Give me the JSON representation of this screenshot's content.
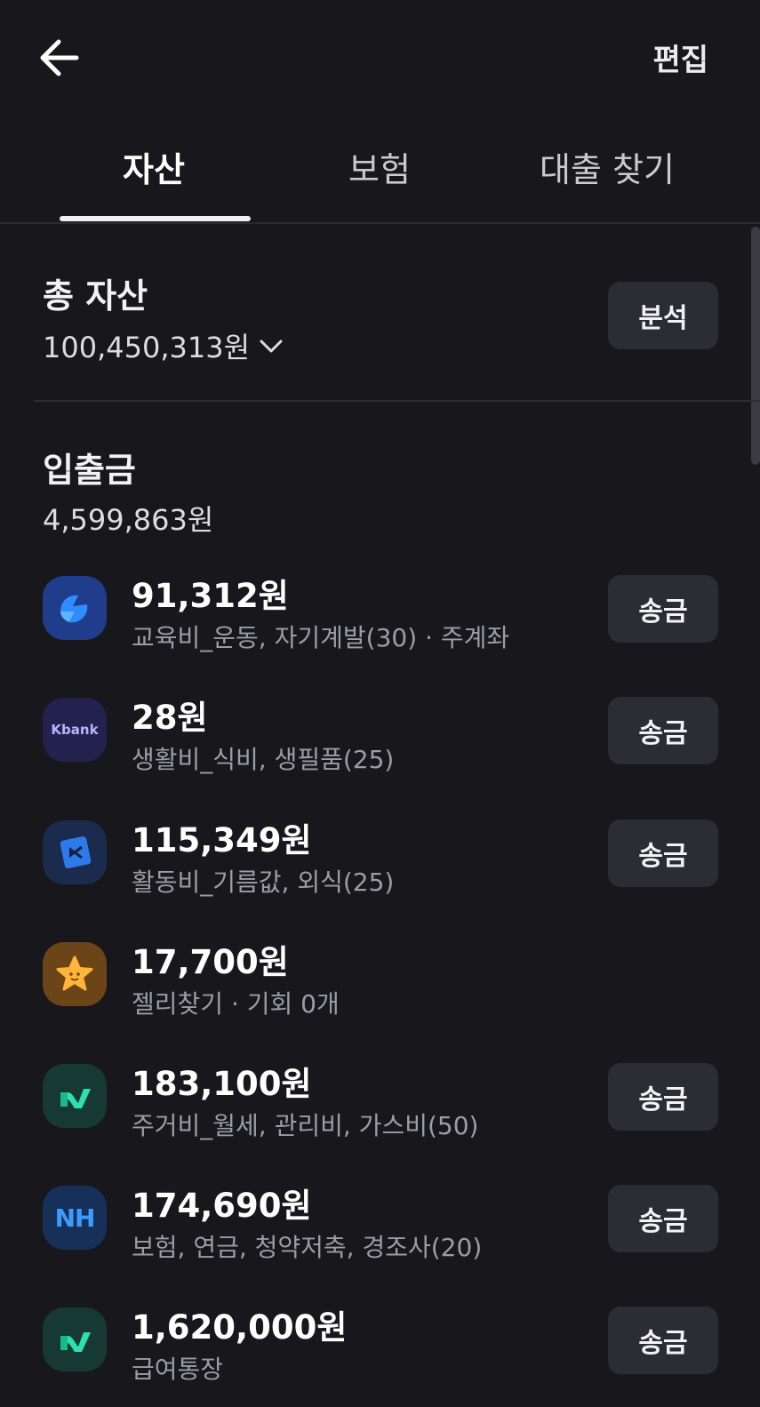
{
  "header": {
    "edit_label": "편집"
  },
  "tabs": [
    {
      "label": "자산",
      "active": true
    },
    {
      "label": "보험",
      "active": false
    },
    {
      "label": "대출 찾기",
      "active": false
    }
  ],
  "summary": {
    "title": "총 자산",
    "amount": "100,450,313원",
    "analysis_label": "분석"
  },
  "section": {
    "title": "입출금",
    "amount": "4,599,863원"
  },
  "send_label": "송금",
  "accounts": [
    {
      "amount": "91,312원",
      "desc": "교육비_운동, 자기계발(30) · 주계좌",
      "logo": "toss-bank-logo",
      "has_send": true
    },
    {
      "amount": "28원",
      "desc": "생활비_식비, 생필품(25)",
      "logo": "kbank-logo",
      "logo_text": "Kbank",
      "has_send": true
    },
    {
      "amount": "115,349원",
      "desc": "활동비_기름값, 외식(25)",
      "logo": "bank-logo-blue",
      "has_send": true
    },
    {
      "amount": "17,700원",
      "desc": "젤리찾기 · 기회 0개",
      "logo": "star-jelly-logo",
      "has_send": false
    },
    {
      "amount": "183,100원",
      "desc": "주거비_월세, 관리비, 가스비(50)",
      "logo": "green-bank-logo",
      "has_send": true
    },
    {
      "amount": "174,690원",
      "desc": "보험, 연금, 청약저축, 경조사(20)",
      "logo": "nh-logo",
      "logo_text": "NH",
      "has_send": true
    },
    {
      "amount": "1,620,000원",
      "desc": "급여통장",
      "logo": "green-bank-logo",
      "has_send": true
    }
  ],
  "colors": {
    "background": "#17171c",
    "button": "#2c2c34",
    "text_secondary": "#9c9ca6"
  }
}
